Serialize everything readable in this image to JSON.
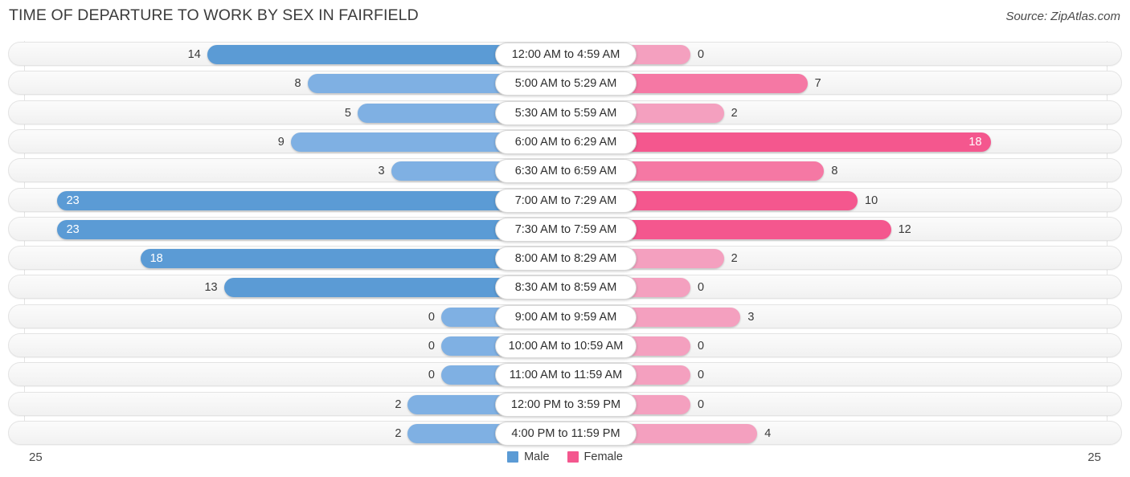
{
  "header": {
    "title": "TIME OF DEPARTURE TO WORK BY SEX IN FAIRFIELD",
    "source": "Source: ZipAtlas.com"
  },
  "footer": {
    "axis_left": "25",
    "axis_right": "25",
    "legend": [
      {
        "label": "Male",
        "color": "#5b9bd5",
        "icon": "male-swatch"
      },
      {
        "label": "Female",
        "color": "#f4578e",
        "icon": "female-swatch"
      }
    ]
  },
  "chart_data": {
    "type": "bar",
    "orientation": "horizontal-diverging",
    "title": "TIME OF DEPARTURE TO WORK BY SEX IN FAIRFIELD",
    "subtitle": "",
    "xlabel": "",
    "ylabel": "",
    "xlim": [
      25,
      25
    ],
    "grid": true,
    "legend_position": "bottom-center",
    "categories": [
      "12:00 AM to 4:59 AM",
      "5:00 AM to 5:29 AM",
      "5:30 AM to 5:59 AM",
      "6:00 AM to 6:29 AM",
      "6:30 AM to 6:59 AM",
      "7:00 AM to 7:29 AM",
      "7:30 AM to 7:59 AM",
      "8:00 AM to 8:29 AM",
      "8:30 AM to 8:59 AM",
      "9:00 AM to 9:59 AM",
      "10:00 AM to 10:59 AM",
      "11:00 AM to 11:59 AM",
      "12:00 PM to 3:59 PM",
      "4:00 PM to 11:59 PM"
    ],
    "series": [
      {
        "name": "Male",
        "color": "#5b9bd5",
        "values": [
          14,
          8,
          5,
          9,
          3,
          23,
          23,
          18,
          13,
          0,
          0,
          0,
          2,
          2
        ]
      },
      {
        "name": "Female",
        "color": "#f4578e",
        "values": [
          0,
          7,
          2,
          18,
          8,
          10,
          12,
          2,
          0,
          3,
          0,
          0,
          0,
          4
        ]
      }
    ]
  }
}
